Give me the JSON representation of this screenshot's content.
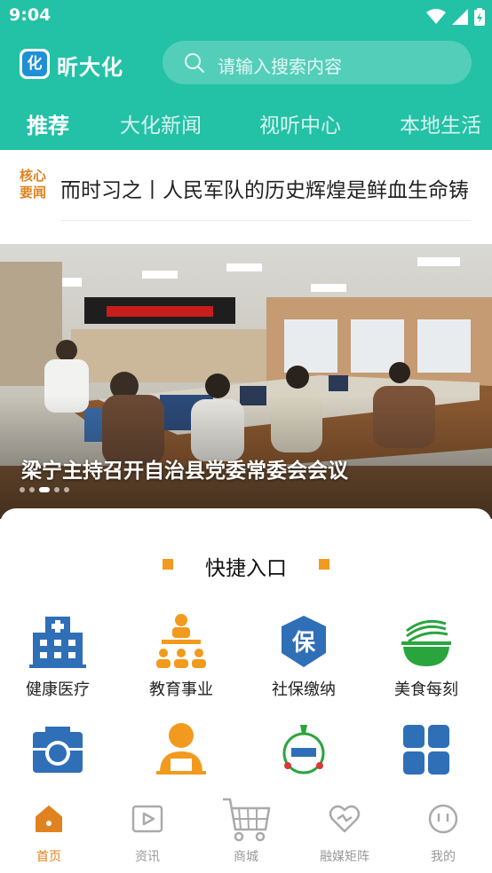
{
  "status_bar": {
    "time": "9:04"
  },
  "header": {
    "app_name": "昕大化",
    "logo_text": "化",
    "search_placeholder": "请输入搜索内容"
  },
  "tabs": [
    {
      "label": "推荐",
      "active": true
    },
    {
      "label": "大化新闻",
      "active": false
    },
    {
      "label": "视听中心",
      "active": false
    },
    {
      "label": "本地生活",
      "active": false
    }
  ],
  "ticker": {
    "badge_line1": "核心",
    "badge_line2": "要闻",
    "headline": "而时习之丨人民军队的历史辉煌是鲜血生命铸就的"
  },
  "banner": {
    "title": "梁宁主持召开自治县党委常委会会议",
    "slide_count": 5,
    "active_slide": 3
  },
  "quick_entry": {
    "title": "快捷入口",
    "items": [
      {
        "label": "健康医疗",
        "icon": "hospital-icon"
      },
      {
        "label": "教育事业",
        "icon": "education-icon"
      },
      {
        "label": "社保缴纳",
        "icon": "social-security-icon"
      },
      {
        "label": "美食每刻",
        "icon": "noodle-bowl-icon"
      },
      {
        "label": "",
        "icon": "camera-icon"
      },
      {
        "label": "",
        "icon": "office-worker-icon"
      },
      {
        "label": "",
        "icon": "map-emblem-icon"
      },
      {
        "label": "",
        "icon": "more-apps-icon"
      }
    ]
  },
  "bottom_nav": [
    {
      "label": "首页",
      "icon": "home-icon",
      "active": true
    },
    {
      "label": "资讯",
      "icon": "video-play-icon",
      "active": false
    },
    {
      "label": "商城",
      "icon": "cart-icon",
      "active": false
    },
    {
      "label": "融媒矩阵",
      "icon": "heart-link-icon",
      "active": false
    },
    {
      "label": "我的",
      "icon": "smile-icon",
      "active": false
    }
  ],
  "colors": {
    "brand_teal": "#23c1a6",
    "accent_orange": "#e0821f",
    "icon_blue": "#2f6fb8",
    "icon_orange": "#f29a1e",
    "icon_green": "#2aa53e"
  }
}
